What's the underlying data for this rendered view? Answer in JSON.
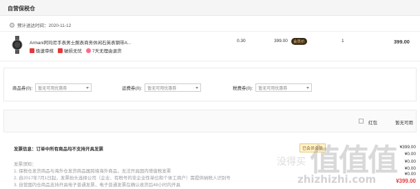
{
  "section": {
    "title": "自营保税仓"
  },
  "delivery": {
    "text": "预计送达时间：2020-11-12"
  },
  "item": {
    "name": "Armani阿玛尼手表男士腕表商务休闲石英表钢带A...",
    "badges": [
      {
        "label": "极速审核",
        "icon": "speed-icon"
      },
      {
        "label": "破损无忧",
        "icon": "shield-icon"
      },
      {
        "label": "7天无理由退货",
        "icon": "return-icon"
      }
    ],
    "tax_rate": "0.30",
    "price": "399.00",
    "member_tag": "会员价",
    "quantity": "1",
    "total": "399.00"
  },
  "coupons": [
    {
      "label": "商品券(0):",
      "placeholder": "暂无可用优惠券"
    },
    {
      "label": "运费券(0):",
      "placeholder": "暂无可用优惠券"
    },
    {
      "label": "税费券(0):",
      "placeholder": "暂无可用优惠券"
    }
  ],
  "redpacket": {
    "label": "红包",
    "value": "暂无可用"
  },
  "invoice": {
    "title": "发票信息：订单中所有商品均不支持开具发票",
    "note_head": "发票须知：",
    "notes": [
      "1. 保税仓发货商品与海外仓发货商品属跨境海外商品，无法开具国内增值税发票",
      "2. 自2017年7月1日起，发票抬头选择公司（企业、有税号的非企业性单位和个体工商户）需提供纳税人识别号",
      "3. 自营国内仓商品支持开具电子普通发票，电子普通发票在确认收货后48小时内开具"
    ]
  },
  "vip": {
    "label": "已会员会员"
  },
  "summary": [
    {
      "value": "¥399.00"
    },
    {
      "value": "¥0.00"
    },
    {
      "value": "¥0.00"
    },
    {
      "value": "¥0.00"
    },
    {
      "value": "¥0.00"
    }
  ],
  "pay_total": "¥399.00",
  "watermark": {
    "big": "值值值",
    "cn": "没得买",
    "small": "zhizhizhi.com"
  }
}
